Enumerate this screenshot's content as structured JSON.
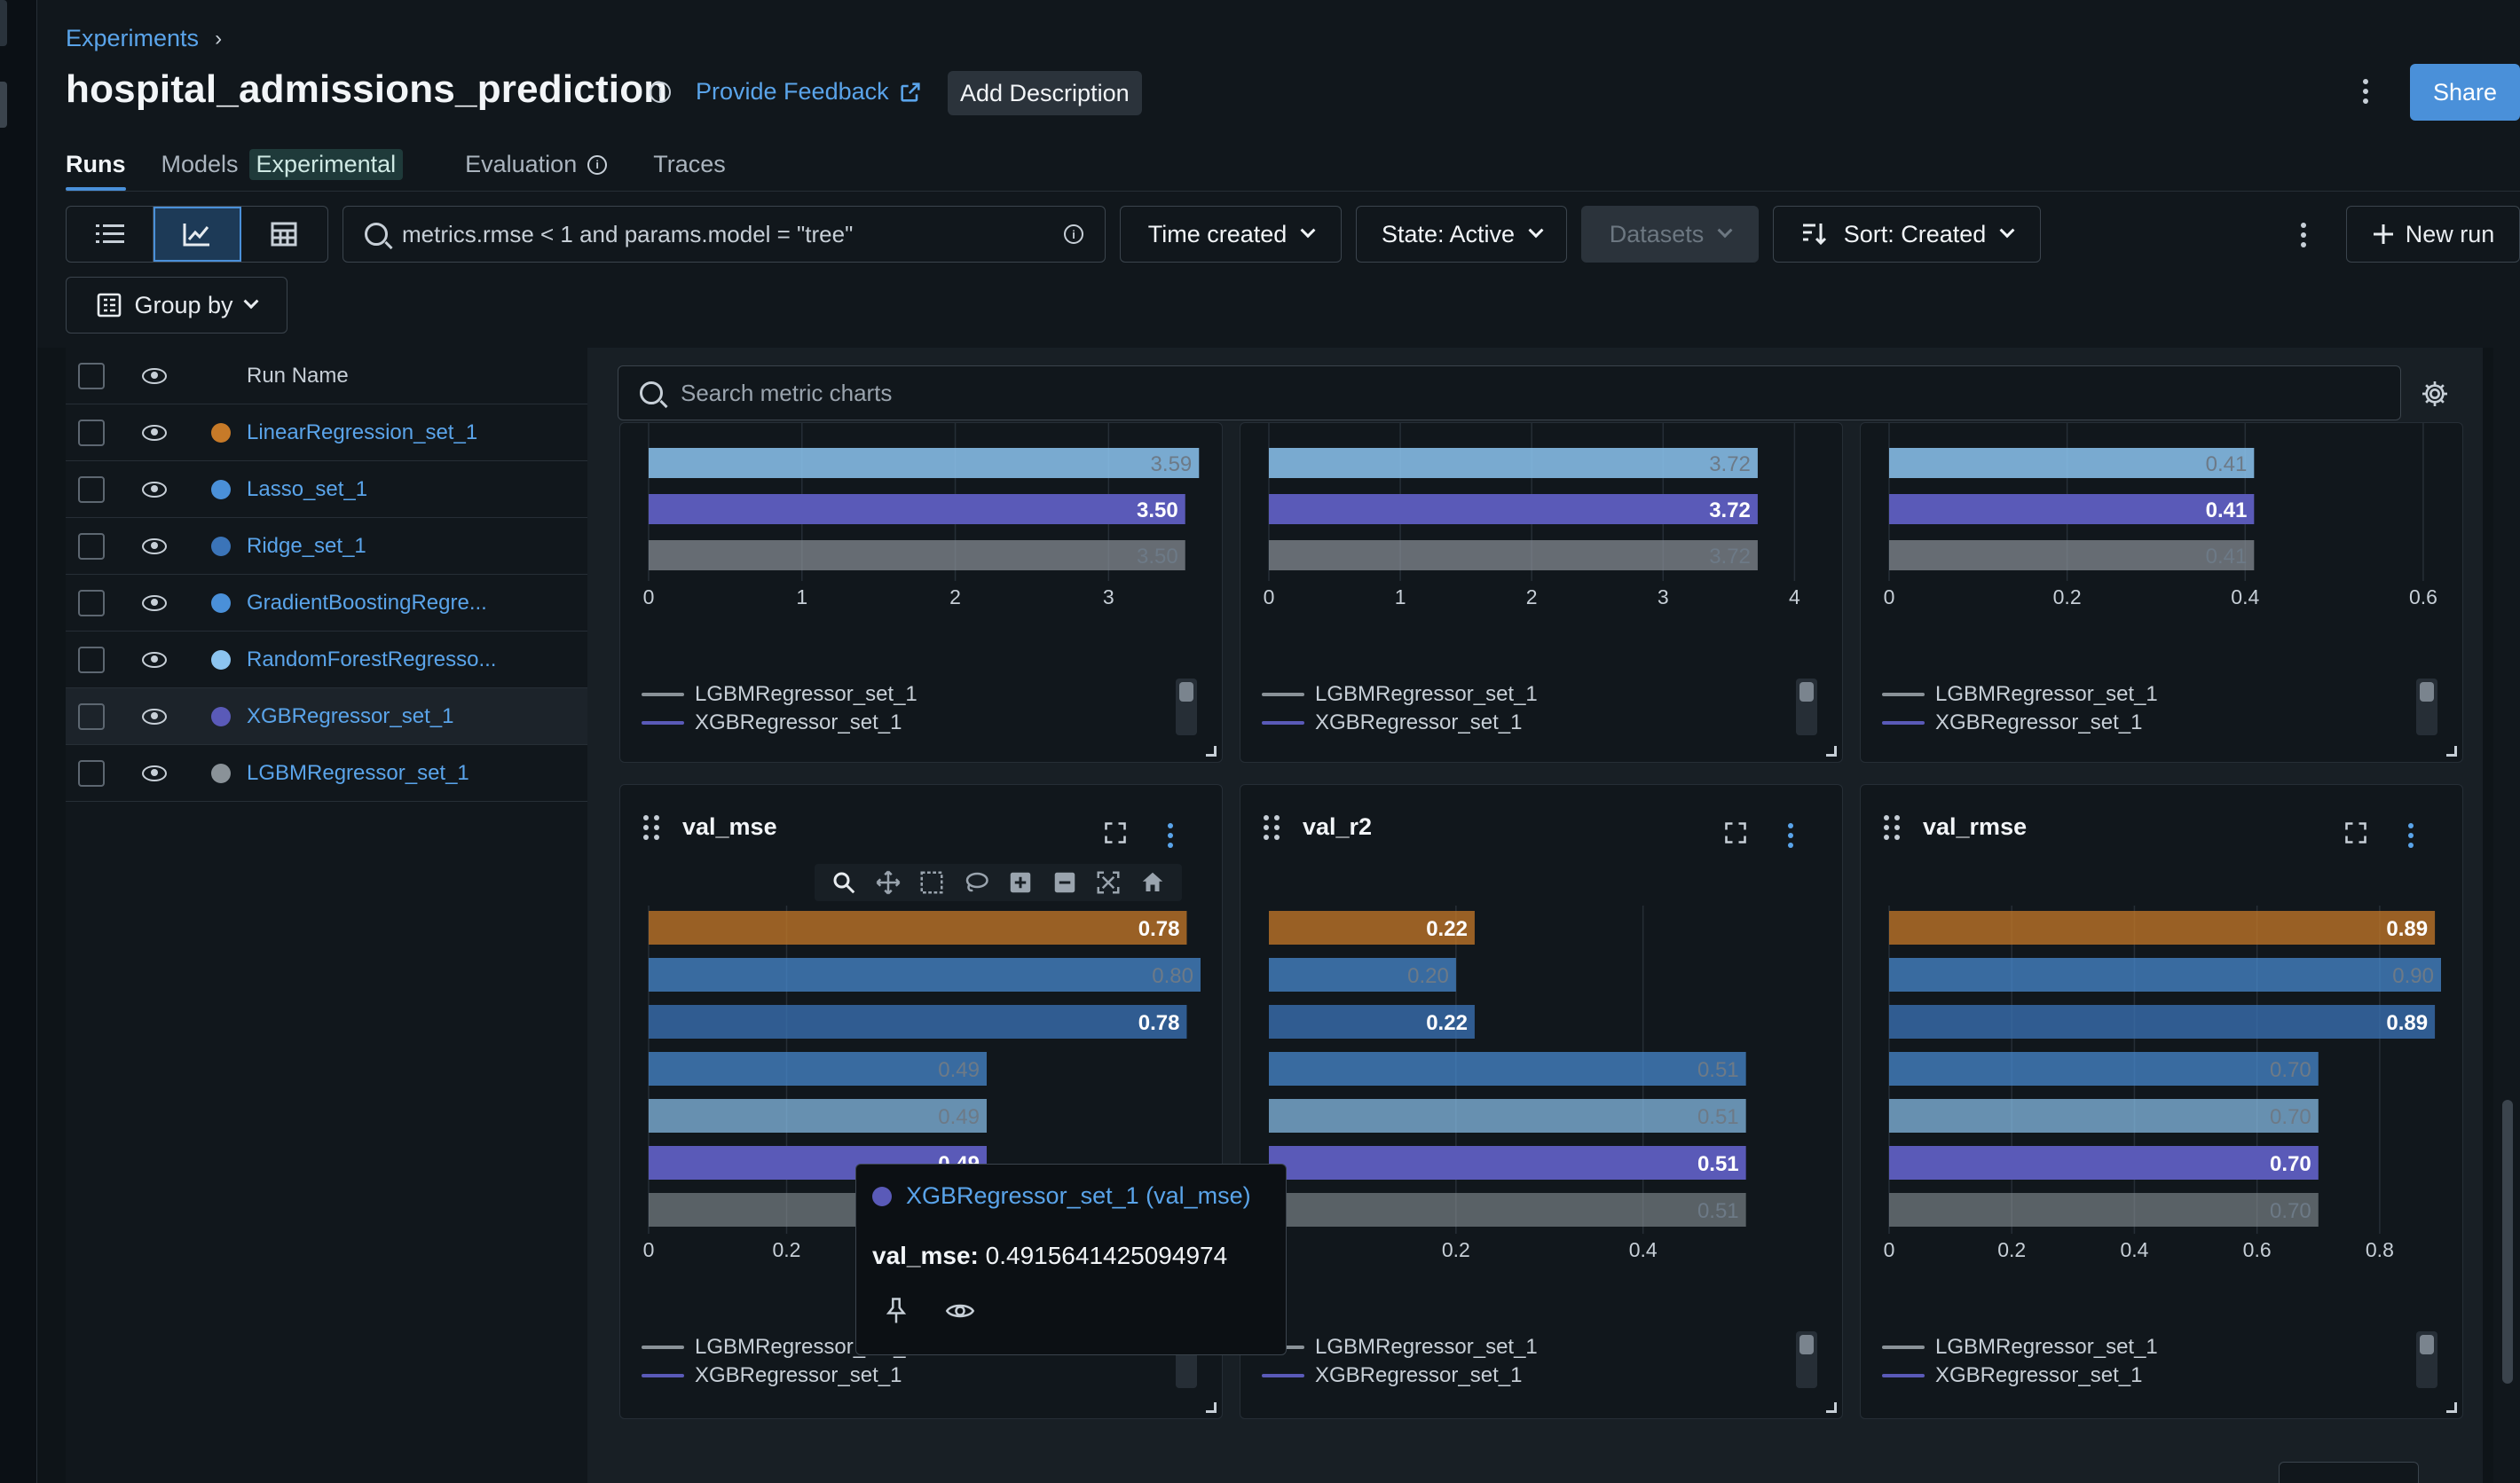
{
  "breadcrumb": {
    "experiments": "Experiments"
  },
  "header": {
    "title": "hospital_admissions_prediction",
    "feedback": "Provide Feedback",
    "add_description": "Add Description",
    "share": "Share"
  },
  "tabs": [
    {
      "label": "Runs"
    },
    {
      "label": "Models",
      "badge": "Experimental"
    },
    {
      "label": "Evaluation"
    },
    {
      "label": "Traces"
    }
  ],
  "toolbar": {
    "search_placeholder": "metrics.rmse < 1 and params.model = \"tree\"",
    "time_created": "Time created",
    "state": "State: Active",
    "datasets": "Datasets",
    "sort": "Sort: Created",
    "new_run": "New run",
    "group_by": "Group by"
  },
  "run_table": {
    "header": "Run Name",
    "rows": [
      {
        "name": "LinearRegression_set_1",
        "color": "#c77a28"
      },
      {
        "name": "Lasso_set_1",
        "color": "#4a90d9"
      },
      {
        "name": "Ridge_set_1",
        "color": "#3b74b8"
      },
      {
        "name": "GradientBoostingRegre...",
        "color": "#4a90d9"
      },
      {
        "name": "RandomForestRegresso...",
        "color": "#8cc4f0"
      },
      {
        "name": "XGBRegressor_set_1",
        "color": "#5a5ab8"
      },
      {
        "name": "LGBMRegressor_set_1",
        "color": "#8a9298"
      }
    ]
  },
  "charts": {
    "search_placeholder": "Search metric charts",
    "legend": [
      "LGBMRegressor_set_1",
      "XGBRegressor_set_1"
    ],
    "colors": [
      "#c77a28",
      "#4a90d9",
      "#3b74b8",
      "#4a90d9",
      "#8cc4f0",
      "#5a5ab8",
      "#8a9298"
    ],
    "top_row": [
      {
        "values": [
          3.59,
          3.5,
          3.5
        ],
        "label_values": [
          "3.59",
          "3.50",
          "3.50"
        ],
        "xmax": 3.6,
        "ticks": [
          "0",
          "1",
          "2",
          "3"
        ],
        "tick_values": [
          0,
          1,
          2,
          3
        ]
      },
      {
        "values": [
          3.72,
          3.72,
          3.72
        ],
        "label_values": [
          "3.72",
          "3.72",
          "3.72"
        ],
        "xmax": 4.2,
        "ticks": [
          "0",
          "1",
          "2",
          "3",
          "4"
        ],
        "tick_values": [
          0,
          1,
          2,
          3,
          4
        ]
      },
      {
        "values": [
          0.41,
          0.41,
          0.41
        ],
        "label_values": [
          "0.41",
          "0.41",
          "0.41"
        ],
        "xmax": 0.62,
        "ticks": [
          "0",
          "0.2",
          "0.4",
          "0.6"
        ],
        "tick_values": [
          0,
          0.2,
          0.4,
          0.6
        ]
      }
    ],
    "bottom_row": [
      {
        "title": "val_mse",
        "values": [
          0.78,
          0.8,
          0.78,
          0.49,
          0.49,
          0.49,
          0.49
        ],
        "label_values": [
          "0.78",
          "0.80",
          "0.78",
          "0.49",
          "0.49",
          "0.49",
          ""
        ],
        "xmax": 0.8,
        "ticks": [
          "0",
          "0.2"
        ],
        "tick_values": [
          0,
          0.2
        ]
      },
      {
        "title": "val_r2",
        "values": [
          0.22,
          0.2,
          0.22,
          0.51,
          0.51,
          0.51,
          0.51
        ],
        "label_values": [
          "0.22",
          "0.20",
          "0.22",
          "0.51",
          "0.51",
          "0.51",
          "0.51"
        ],
        "xmax": 0.59,
        "ticks": [
          "0.2",
          "0.4"
        ],
        "tick_values": [
          0.2,
          0.4
        ]
      },
      {
        "title": "val_rmse",
        "values": [
          0.89,
          0.9,
          0.89,
          0.7,
          0.7,
          0.7,
          0.7
        ],
        "label_values": [
          "0.89",
          "0.90",
          "0.89",
          "0.70",
          "0.70",
          "0.70",
          "0.70"
        ],
        "xmax": 0.9,
        "ticks": [
          "0",
          "0.2",
          "0.4",
          "0.6",
          "0.8"
        ],
        "tick_values": [
          0,
          0.2,
          0.4,
          0.6,
          0.8
        ]
      }
    ]
  },
  "tooltip": {
    "title": "XGBRegressor_set_1 (val_mse)",
    "metric": "val_mse:",
    "value": "0.4915641425094974"
  }
}
